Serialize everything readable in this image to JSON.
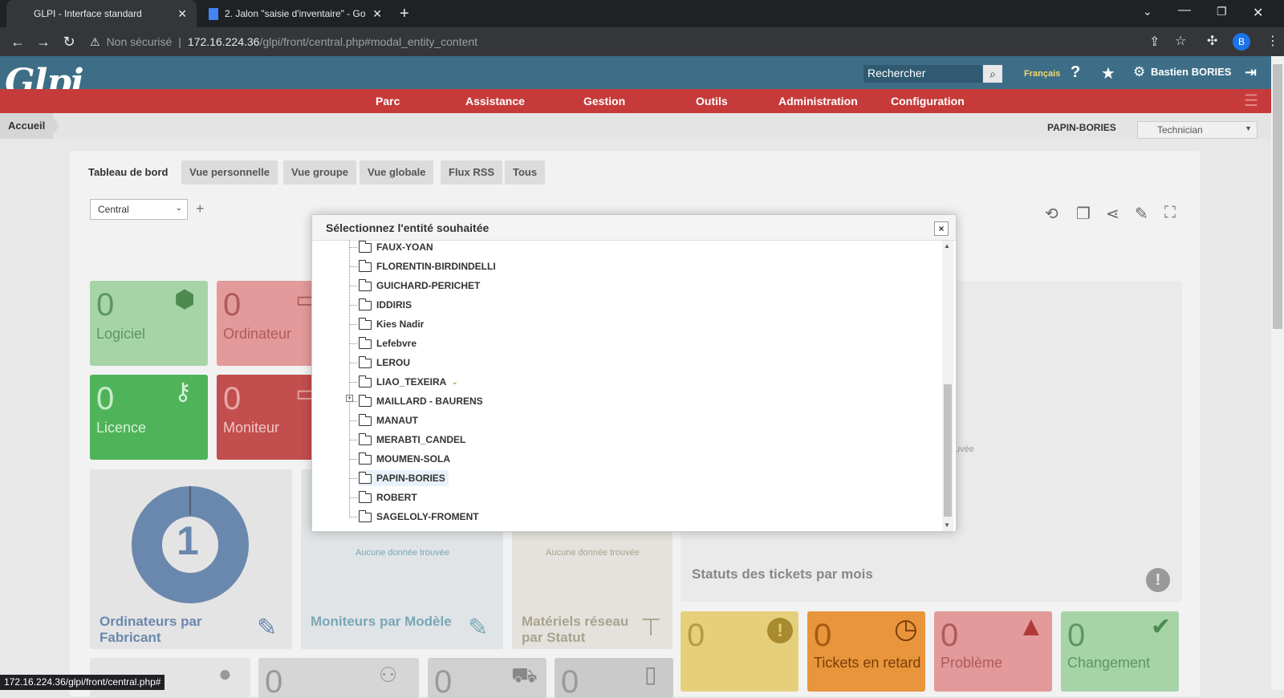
{
  "browser": {
    "tabs": [
      {
        "title": "GLPI - Interface standard"
      },
      {
        "title": "2. Jalon \"saisie d'inventaire\" - Go"
      }
    ],
    "security": "Non sécurisé",
    "url_host": "172.16.224.36",
    "url_path": "/glpi/front/central.php#modal_entity_content",
    "profile_initial": "B",
    "status_url": "172.16.224.36/glpi/front/central.php#"
  },
  "header": {
    "logo": "Glpi",
    "search_placeholder": "Rechercher",
    "language": "Français",
    "user": "Bastien BORIES",
    "menu": [
      "Parc",
      "Assistance",
      "Gestion",
      "Outils",
      "Administration",
      "Configuration"
    ]
  },
  "breadcrumb": {
    "home": "Accueil",
    "entity": "PAPIN-BORIES",
    "profile": "Technician"
  },
  "dashboard": {
    "tabs": [
      "Tableau de bord",
      "Vue personnelle",
      "Vue groupe",
      "Vue globale",
      "Flux RSS",
      "Tous"
    ],
    "selector": "Central",
    "add": "+",
    "cards": [
      {
        "num": "0",
        "label": "Logiciel"
      },
      {
        "num": "0",
        "label": "Ordinateur"
      },
      {
        "num": "0",
        "label": "Licence"
      },
      {
        "num": "0",
        "label": "Moniteur"
      }
    ],
    "donut_value": "1",
    "widgets": [
      {
        "title": "Ordinateurs par Fabricant"
      },
      {
        "title": "Moniteurs par Modèle",
        "empty": "Aucune donnée trouvée"
      },
      {
        "title": "Matériels réseau par Statut",
        "empty": "Aucune donnée trouvée"
      }
    ],
    "tickets_chart_title": "Statuts des tickets par mois",
    "tickets_chart_partial": "uvée",
    "ticket_cards": [
      {
        "num": "0",
        "label": ""
      },
      {
        "num": "0",
        "label": "Tickets en retard"
      },
      {
        "num": "0",
        "label": "Problème"
      },
      {
        "num": "0",
        "label": "Changement"
      }
    ],
    "bottom_cards": [
      "0",
      "0",
      "0"
    ]
  },
  "modal": {
    "title": "Sélectionnez l'entité souhaitée",
    "close": "×",
    "entities": [
      "FAUX-YOAN",
      "FLORENTIN-BIRDINDELLI",
      "GUICHARD-PERICHET",
      "IDDIRIS",
      "Kies Nadir",
      "Lefebvre",
      "LEROU",
      "LIAO_TEXEIRA",
      "MAILLARD - BAURENS",
      "MANAUT",
      "MERABTI_CANDEL",
      "MOUMEN-SOLA",
      "PAPIN-BORIES",
      "ROBERT",
      "SAGELOLY-FROMENT"
    ],
    "selected": "PAPIN-BORIES",
    "expandable": "LIAO_TEXEIRA"
  }
}
